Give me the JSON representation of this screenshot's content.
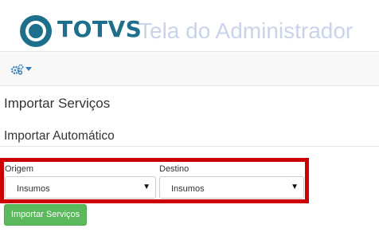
{
  "header": {
    "brand": "TOTVS",
    "subtitle": "Tela do Administrador",
    "logo_icon": "totvs-logo-icon"
  },
  "navbar": {
    "menu_icon": "gears-icon",
    "dropdown_icon": "caret-down-icon"
  },
  "page": {
    "title": "Importar Serviços",
    "section_title": "Importar Automático"
  },
  "form": {
    "origem_label": "Origem",
    "origem_value": "Insumos",
    "destino_label": "Destino",
    "destino_value": "Insumos",
    "submit_label": "Importar Serviços"
  },
  "colors": {
    "brand": "#1d6f8c",
    "subtitle": "#c9d3ea",
    "highlight": "#cc0000",
    "button": "#5cb85c"
  }
}
